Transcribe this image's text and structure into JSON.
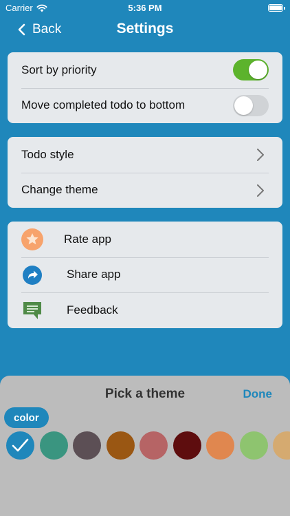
{
  "status_bar": {
    "carrier": "Carrier",
    "time": "5:36 PM"
  },
  "nav": {
    "back_label": "Back",
    "title": "Settings"
  },
  "sort_card": {
    "items": [
      {
        "label": "Sort by priority",
        "toggle_on": true
      },
      {
        "label": "Move completed todo to bottom",
        "toggle_on": false
      }
    ]
  },
  "style_card": {
    "items": [
      {
        "label": "Todo style"
      },
      {
        "label": "Change theme"
      }
    ]
  },
  "app_card": {
    "items": [
      {
        "label": "Rate app",
        "icon": "star-icon",
        "color": "#f7a36c"
      },
      {
        "label": "Share app",
        "icon": "share-arrow-icon",
        "color": "#1f7fc3"
      },
      {
        "label": "Feedback",
        "icon": "chat-bubble-icon",
        "color": "#4f8a47"
      }
    ]
  },
  "theme_sheet": {
    "title": "Pick a theme",
    "done_label": "Done",
    "tab_label": "color",
    "selected_index": 0,
    "swatches": [
      "#1f87bb",
      "#3a9580",
      "#5c4f55",
      "#9a5713",
      "#b66465",
      "#5e0d0e",
      "#e0874f",
      "#8ec46f",
      "#d5aa70"
    ]
  },
  "colors": {
    "background": "#1f87bb",
    "toggle_on": "#5cb32c",
    "card": "#e6e9ec"
  }
}
